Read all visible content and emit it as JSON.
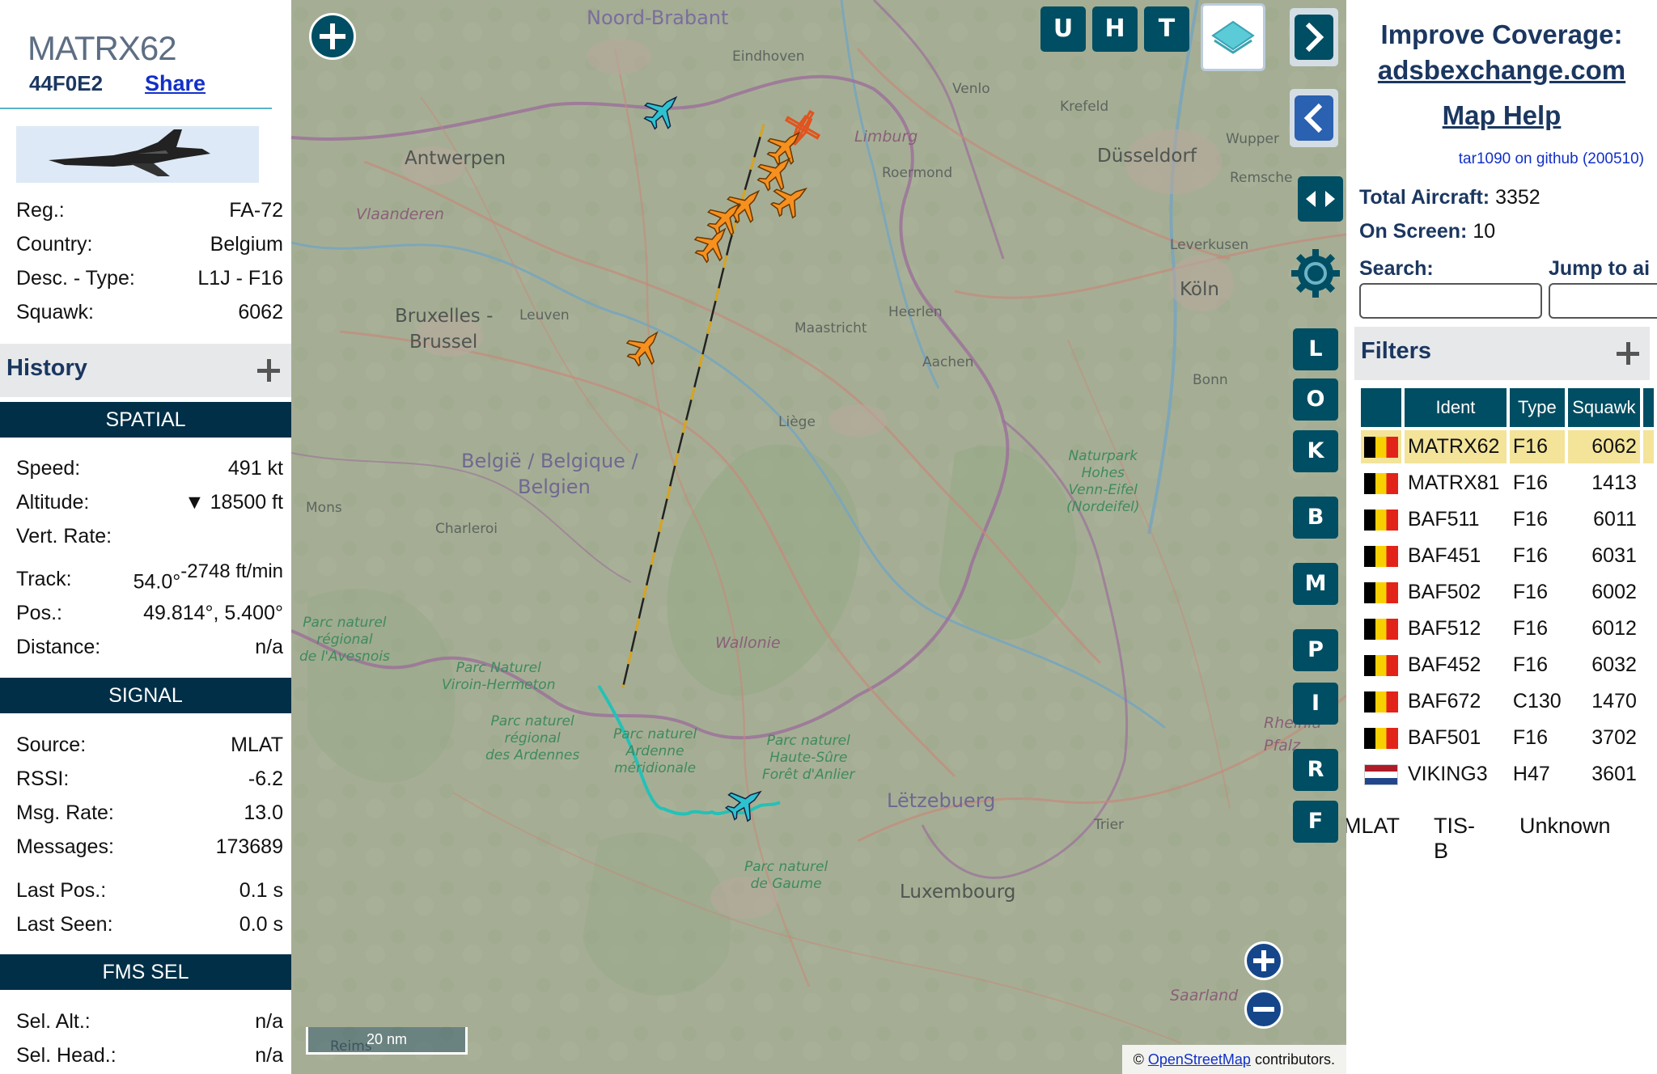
{
  "aircraft": {
    "callsign": "MATRX62",
    "hex": "44F0E2",
    "share_label": "Share",
    "details": [
      {
        "label": "Reg.:",
        "value": "FA-72"
      },
      {
        "label": "Country:",
        "value": "Belgium"
      },
      {
        "label": "Desc. - Type:",
        "value": "L1J - F16"
      },
      {
        "label": "Squawk:",
        "value": "6062"
      }
    ]
  },
  "history_label": "History",
  "sections": {
    "spatial": "SPATIAL",
    "signal": "SIGNAL",
    "fms": "FMS SEL"
  },
  "spatial": {
    "speed": {
      "label": "Speed:",
      "value": "491 kt"
    },
    "altitude": {
      "label": "Altitude:",
      "arrow": "▼",
      "value": "18500 ft"
    },
    "vert_rate": {
      "label": "Vert. Rate:",
      "value": "-2748 ft/min"
    },
    "track": {
      "label": "Track:",
      "value": "54.0°"
    },
    "pos": {
      "label": "Pos.:",
      "value": "49.814°, 5.400°"
    },
    "distance": {
      "label": "Distance:",
      "value": "n/a"
    }
  },
  "signal": [
    {
      "label": "Source:",
      "value": "MLAT"
    },
    {
      "label": "RSSI:",
      "value": "-6.2"
    },
    {
      "label": "Msg. Rate:",
      "value": "13.0"
    },
    {
      "label": "Messages:",
      "value": "173689"
    },
    {
      "label": "Last Pos.:",
      "value": "0.1 s"
    },
    {
      "label": "Last Seen:",
      "value": "0.0 s"
    }
  ],
  "fms": [
    {
      "label": "Sel. Alt.:",
      "value": "n/a"
    },
    {
      "label": "Sel. Head.:",
      "value": "n/a"
    }
  ],
  "map": {
    "places": {
      "noord_brabant": "Noord-Brabant",
      "eindhoven": "Eindhoven",
      "venlo": "Venlo",
      "krefeld": "Krefeld",
      "antwerpen": "Antwerpen",
      "limburg": "Limburg",
      "roermond": "Roermond",
      "dusseldorf": "Düsseldorf",
      "wuppertal": "Wupper",
      "remscheid": "Remsche",
      "vlaanderen": "Vlaanderen",
      "leverkusen": "Leverkusen",
      "koln": "Köln",
      "bruxelles": "Bruxelles -",
      "brussel": "Brussel",
      "leuven": "Leuven",
      "maastricht": "Maastricht",
      "heerlen": "Heerlen",
      "aachen": "Aachen",
      "bonn": "Bonn",
      "liege": "Liège",
      "belgie1": "België / Belgique /",
      "belgie2": "Belgien",
      "mons": "Mons",
      "charleroi": "Charleroi",
      "nat_hohes": "Naturpark\nHohes\nVenn-Eifel\n(Nordeifel)",
      "avesnois": "Parc naturel\nrégional\nde l'Avesnois",
      "wallonie": "Wallonie",
      "viroin": "Parc Naturel\nViroin-Hermeton",
      "ardennes": "Parc naturel\nrégional\ndes Ardennes",
      "ardenne_mer": "Parc naturel\nArdenne\nméridionale",
      "haute_sure": "Parc naturel\nHaute-Sûre\nForêt d'Anlier",
      "letzebuerg": "Lëtzebuerg",
      "rheinland": "Rheinla\nPfalz",
      "trier": "Trier",
      "gaume": "Parc naturel\nde Gaume",
      "luxembourg": "Luxembourg",
      "saarland": "Saarland",
      "reims": "Reims"
    },
    "buttons": {
      "u": "U",
      "h": "H",
      "t": "T"
    },
    "side_buttons": [
      "L",
      "O",
      "K",
      "B",
      "M",
      "P",
      "I",
      "R",
      "F"
    ],
    "scale_label": "20 nm",
    "attribution_prefix": "©",
    "attribution_link": "OpenStreetMap",
    "attribution_suffix": "contributors."
  },
  "sidebar": {
    "improve_title": "Improve Coverage:",
    "improve_link": "adsbexchange.com",
    "map_help": "Map Help",
    "github": "tar1090 on github (200510)",
    "total_label": "Total Aircraft:",
    "total_value": "3352",
    "onscreen_label": "On Screen:",
    "onscreen_value": "10",
    "search_label": "Search:",
    "jump_label": "Jump to ai",
    "filters_label": "Filters"
  },
  "table": {
    "headers": [
      "",
      "Ident",
      "Type",
      "Squawk",
      ""
    ],
    "rows": [
      {
        "flag": "be",
        "ident": "MATRX62",
        "type": "F16",
        "squawk": "6062",
        "selected": true
      },
      {
        "flag": "be",
        "ident": "MATRX81",
        "type": "F16",
        "squawk": "1413"
      },
      {
        "flag": "be",
        "ident": "BAF511",
        "type": "F16",
        "squawk": "6011"
      },
      {
        "flag": "be",
        "ident": "BAF451",
        "type": "F16",
        "squawk": "6031"
      },
      {
        "flag": "be",
        "ident": "BAF502",
        "type": "F16",
        "squawk": "6002"
      },
      {
        "flag": "be",
        "ident": "BAF512",
        "type": "F16",
        "squawk": "6012"
      },
      {
        "flag": "be",
        "ident": "BAF452",
        "type": "F16",
        "squawk": "6032"
      },
      {
        "flag": "be",
        "ident": "BAF672",
        "type": "C130",
        "squawk": "1470"
      },
      {
        "flag": "be",
        "ident": "BAF501",
        "type": "F16",
        "squawk": "3702"
      },
      {
        "flag": "nl",
        "ident": "VIKING3",
        "type": "H47",
        "squawk": "3601"
      }
    ]
  },
  "legend": {
    "mlat": "MLAT",
    "tisb1": "TIS-",
    "tisb2": "B",
    "unknown": "Unknown"
  },
  "colors": {
    "header_bg": "#002f47",
    "button_bg": "#004e63",
    "selected_row": "#f3e49a",
    "aircraft_orange": "#f6901e",
    "aircraft_cyan": "#2ec2cf",
    "title_blue": "#1b3760"
  }
}
